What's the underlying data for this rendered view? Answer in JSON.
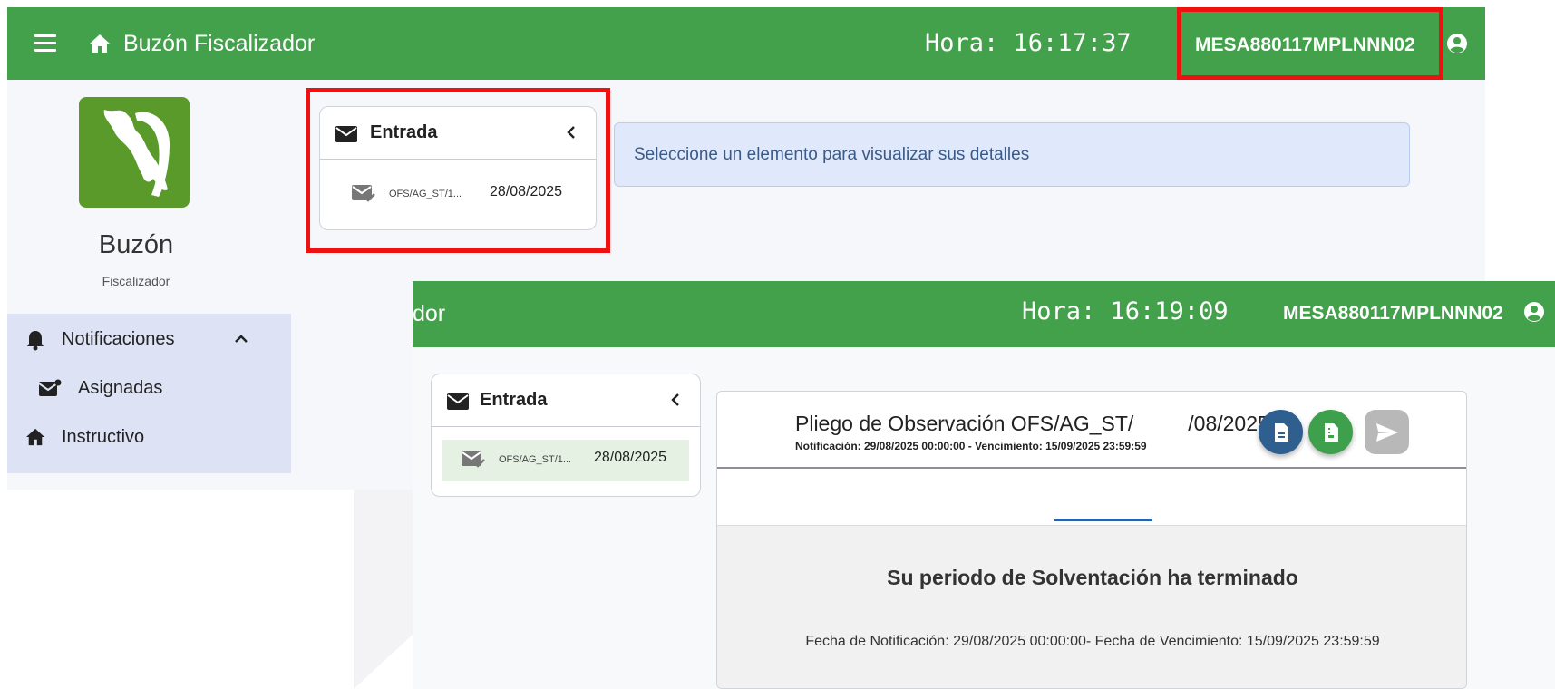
{
  "colors": {
    "primary_green": "#43a04b",
    "highlight_red": "#ef1010",
    "nav_bg": "#dde2f4",
    "info_bg": "#dfe9fb",
    "send_disabled": "#b8b8b8"
  },
  "header": {
    "app_title": "Buzón Fiscalizador",
    "clock_label": "Hora: 16:17:37",
    "user_id": "MESA880117MPLNNN02",
    "icons": [
      "menu-icon",
      "home-icon",
      "account-icon"
    ]
  },
  "logo": {
    "name": "Buzón",
    "subtitle": "Fiscalizador"
  },
  "sidebar": {
    "items": [
      {
        "label": "Notificaciones",
        "icon": "bell-icon",
        "expanded": true
      },
      {
        "label": "Asignadas",
        "icon": "assigned-mail-icon"
      },
      {
        "label": "Instructivo",
        "icon": "home-icon"
      }
    ]
  },
  "inbox": {
    "title": "Entrada",
    "messages": [
      {
        "ref": "OFS/AG_ST/1...",
        "date": "28/08/2025"
      }
    ]
  },
  "info_message": "Seleccione un elemento para visualizar sus detalles",
  "overlay": {
    "title_fragment": "dor",
    "clock_label": "Hora: 16:19:09",
    "user_id": "MESA880117MPLNNN02",
    "inbox": {
      "title": "Entrada",
      "messages": [
        {
          "ref": "OFS/AG_ST/1...",
          "date": "28/08/2025"
        }
      ]
    },
    "detail": {
      "title_prefix": "Pliego de Observación OFS/AG_ST/",
      "title_suffix": "/08/2025",
      "subtitle": "Notificación: 29/08/2025 00:00:00 - Vencimiento: 15/09/2025 23:59:59",
      "status_title": "Su periodo de Solventación ha terminado",
      "status_dates": "Fecha de Notificación: 29/08/2025 00:00:00- Fecha de Vencimiento: 15/09/2025 23:59:59",
      "buttons": [
        {
          "icon": "document-icon",
          "color": "#2f5f8e"
        },
        {
          "icon": "document-icon",
          "color": "#3ea04c"
        },
        {
          "icon": "send-icon",
          "color": "#b8b8b8"
        }
      ]
    }
  }
}
